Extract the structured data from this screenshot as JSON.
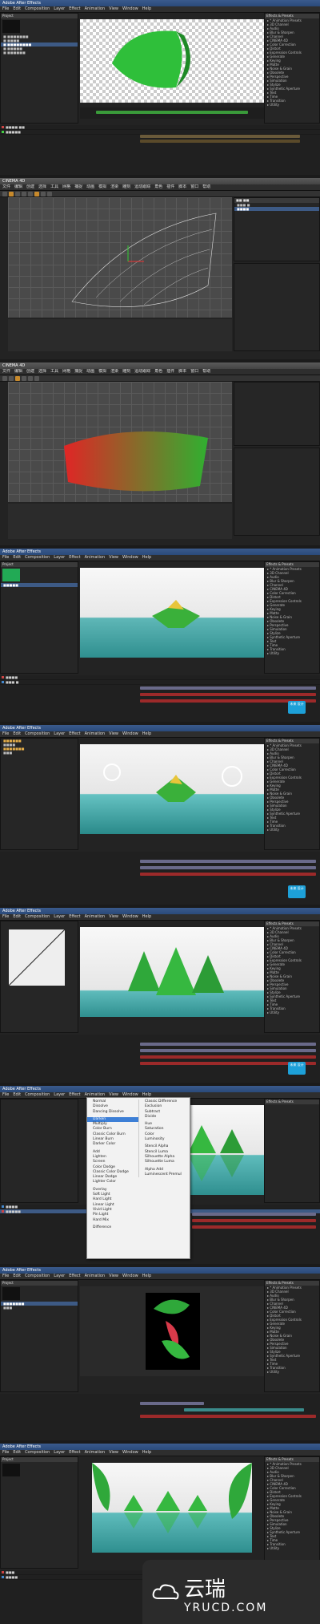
{
  "ae_title": "Adobe After Effects",
  "c4d_title": "CINEMA 4D",
  "ae_menu": [
    "File",
    "Edit",
    "Composition",
    "Layer",
    "Effect",
    "Animation",
    "View",
    "Window",
    "Help"
  ],
  "c4d_menu": [
    "文件",
    "编辑",
    "创建",
    "选择",
    "工具",
    "网格",
    "捕捉",
    "动画",
    "模拟",
    "渲染",
    "雕刻",
    "运动跟踪",
    "角色",
    "插件",
    "脚本",
    "窗口",
    "帮助"
  ],
  "effects_panel_title": "Effects & Presets",
  "effects_list": [
    "* Animation Presets",
    "3D Channel",
    "Audio",
    "Blur & Sharpen",
    "Channel",
    "CINEMA 4D",
    "Color Correction",
    "Distort",
    "Expression Controls",
    "Generate",
    "Keying",
    "Matte",
    "Noise & Grain",
    "Obsolete",
    "Perspective",
    "Simulation",
    "Stylize",
    "Synthetic Aperture",
    "Text",
    "Time",
    "Transition",
    "Utility"
  ],
  "composition_label": "Composition",
  "project_label": "Project",
  "timeline_label": "Timeline",
  "blend_menu": {
    "left": [
      "Normal",
      "Dissolve",
      "Dancing Dissolve",
      "",
      "Darken",
      "Multiply",
      "Color Burn",
      "Classic Color Burn",
      "Linear Burn",
      "Darker Color",
      "",
      "Add",
      "Lighten",
      "Screen",
      "Color Dodge",
      "Classic Color Dodge",
      "Linear Dodge",
      "Lighter Color",
      "",
      "Overlay",
      "Soft Light",
      "Hard Light",
      "Linear Light",
      "Vivid Light",
      "Pin Light",
      "Hard Mix",
      "",
      "Difference"
    ],
    "right": [
      "Classic Difference",
      "Exclusion",
      "Subtract",
      "Divide",
      "",
      "Hue",
      "Saturation",
      "Color",
      "Luminosity",
      "",
      "Stencil Alpha",
      "Stencil Luma",
      "Silhouette Alpha",
      "Silhouette Luma",
      "",
      "Alpha Add",
      "Luminescent Premul"
    ],
    "highlight": "Darken"
  },
  "badge_text": "未来 设计",
  "watermark": {
    "brand": "云瑞",
    "url": "YRUCD.COM"
  },
  "colors": {
    "leaf_green": "#2fbf3a",
    "accent_blue": "#3d5a85",
    "brand_blue": "#1da0d8",
    "layer_red": "#9c2a2a"
  }
}
